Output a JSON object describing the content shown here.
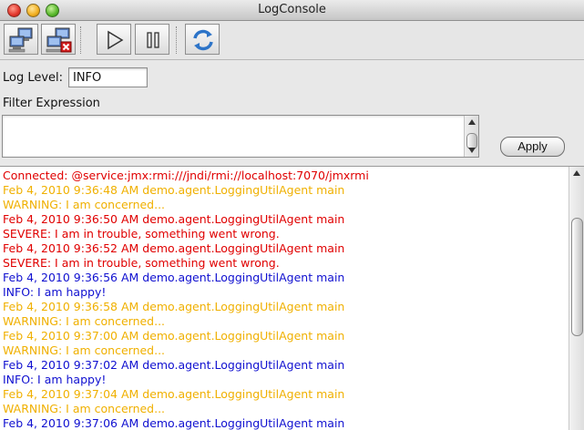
{
  "window": {
    "title": "LogConsole"
  },
  "toolbar": {
    "connect_icon": "connect-computers-icon",
    "disconnect_icon": "disconnect-computers-icon",
    "play_icon": "play-icon",
    "pause_icon": "pause-icon",
    "refresh_icon": "refresh-icon"
  },
  "log_level": {
    "label": "Log Level:",
    "value": "INFO"
  },
  "filter": {
    "label": "Filter Expression",
    "value": ""
  },
  "apply_label": "Apply",
  "colors": {
    "red": "#e00000",
    "orange": "#f0b000",
    "blue": "#1010d0"
  },
  "log": [
    {
      "text": "Connected: @service:jmx:rmi:///jndi/rmi://localhost:7070/jmxrmi",
      "color": "red"
    },
    {
      "text": "Feb 4, 2010 9:36:48 AM demo.agent.LoggingUtilAgent main",
      "color": "orange"
    },
    {
      "text": "WARNING: I am concerned...",
      "color": "orange"
    },
    {
      "text": "Feb 4, 2010 9:36:50 AM demo.agent.LoggingUtilAgent main",
      "color": "red"
    },
    {
      "text": "SEVERE: I am in trouble, something went wrong.",
      "color": "red"
    },
    {
      "text": "Feb 4, 2010 9:36:52 AM demo.agent.LoggingUtilAgent main",
      "color": "red"
    },
    {
      "text": "SEVERE: I am in trouble, something went wrong.",
      "color": "red"
    },
    {
      "text": "Feb 4, 2010 9:36:56 AM demo.agent.LoggingUtilAgent main",
      "color": "blue"
    },
    {
      "text": "INFO: I am happy!",
      "color": "blue"
    },
    {
      "text": "Feb 4, 2010 9:36:58 AM demo.agent.LoggingUtilAgent main",
      "color": "orange"
    },
    {
      "text": "WARNING: I am concerned...",
      "color": "orange"
    },
    {
      "text": "Feb 4, 2010 9:37:00 AM demo.agent.LoggingUtilAgent main",
      "color": "orange"
    },
    {
      "text": "WARNING: I am concerned...",
      "color": "orange"
    },
    {
      "text": "Feb 4, 2010 9:37:02 AM demo.agent.LoggingUtilAgent main",
      "color": "blue"
    },
    {
      "text": "INFO: I am happy!",
      "color": "blue"
    },
    {
      "text": "Feb 4, 2010 9:37:04 AM demo.agent.LoggingUtilAgent main",
      "color": "orange"
    },
    {
      "text": "WARNING: I am concerned...",
      "color": "orange"
    },
    {
      "text": "Feb 4, 2010 9:37:06 AM demo.agent.LoggingUtilAgent main",
      "color": "blue"
    }
  ]
}
